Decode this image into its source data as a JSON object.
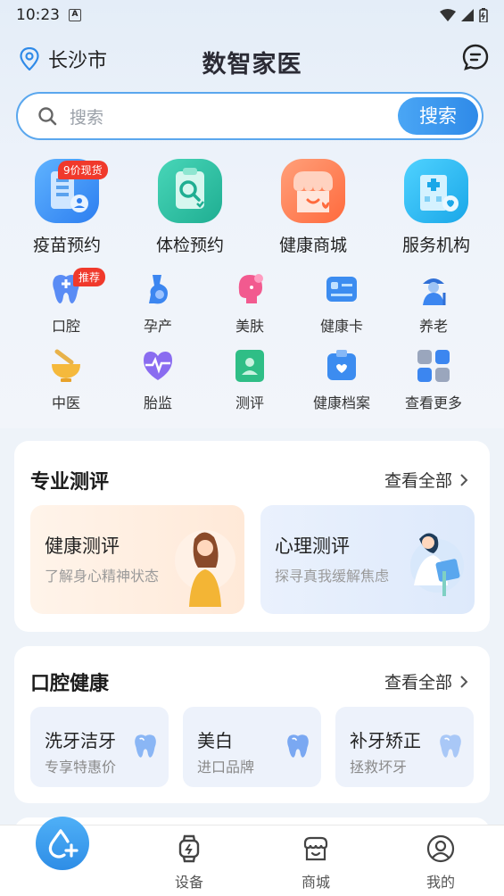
{
  "status_bar": {
    "time": "10:23"
  },
  "header": {
    "city": "长沙市",
    "brand": "数智家医"
  },
  "search": {
    "placeholder": "搜索",
    "button": "搜索"
  },
  "big_items": [
    {
      "label": "疫苗预约",
      "badge": "9价现货"
    },
    {
      "label": "体检预约"
    },
    {
      "label": "健康商城"
    },
    {
      "label": "服务机构"
    }
  ],
  "small_items": [
    {
      "label": "口腔",
      "badge": "推荐"
    },
    {
      "label": "孕产"
    },
    {
      "label": "美肤"
    },
    {
      "label": "健康卡"
    },
    {
      "label": "养老"
    },
    {
      "label": "中医"
    },
    {
      "label": "胎监"
    },
    {
      "label": "测评"
    },
    {
      "label": "健康档案"
    },
    {
      "label": "查看更多"
    }
  ],
  "eval_section": {
    "title": "专业测评",
    "more": "查看全部",
    "cards": [
      {
        "title": "健康测评",
        "subtitle": "了解身心精神状态"
      },
      {
        "title": "心理测评",
        "subtitle": "探寻真我缓解焦虑"
      }
    ]
  },
  "oral_section": {
    "title": "口腔健康",
    "more": "查看全部",
    "cards": [
      {
        "title": "洗牙洁牙",
        "subtitle": "专享特惠价"
      },
      {
        "title": "美白",
        "subtitle": "进口品牌"
      },
      {
        "title": "补牙矫正",
        "subtitle": "拯救坏牙"
      }
    ]
  },
  "tabbar": {
    "tabs": [
      {
        "label": "设备"
      },
      {
        "label": "商城"
      },
      {
        "label": "我的"
      }
    ]
  },
  "colors": {
    "accent": "#2f8ae8",
    "badge": "#f0392b"
  }
}
